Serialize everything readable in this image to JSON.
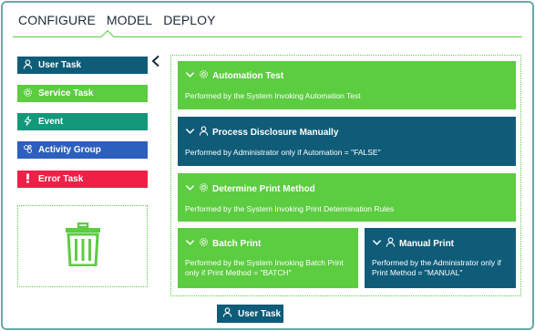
{
  "nav": {
    "tabs": [
      "CONFIGURE",
      "MODEL",
      "DEPLOY"
    ],
    "active": "MODEL"
  },
  "palette": {
    "items": [
      {
        "label": "User Task",
        "color": "#0f5c79",
        "icon": "user-icon"
      },
      {
        "label": "Service Task",
        "color": "#5ccc41",
        "icon": "gear-icon"
      },
      {
        "label": "Event",
        "color": "#14987a",
        "icon": "lightning-icon"
      },
      {
        "label": "Activity Group",
        "color": "#2d5fbf",
        "icon": "group-icon"
      },
      {
        "label": "Error Task",
        "color": "#ef2046",
        "icon": "exclamation-icon"
      }
    ],
    "trash_icon": "trash-icon"
  },
  "canvas": {
    "cards": [
      {
        "title": "Automation Test",
        "desc": "Performed by the System Invoking Automation Test",
        "color": "#5ccc41",
        "icon": "gear-icon"
      },
      {
        "title": "Process Disclosure Manually",
        "desc": "Performed by Administrator only if Automation = \"FALSE\"",
        "color": "#0f5c79",
        "icon": "user-icon"
      },
      {
        "title": "Determine Print Method",
        "desc": "Performed by the System Invoking Print Determination Rules",
        "color": "#5ccc41",
        "icon": "gear-icon"
      },
      {
        "title": "Batch Print",
        "desc": "Performed by the System Invoking Batch Print only if Print Method = \"BATCH\"",
        "color": "#5ccc41",
        "icon": "gear-icon"
      },
      {
        "title": "Manual Print",
        "desc": "Performed by the Administrator only if Print Method = \"MANUAL\"",
        "color": "#0f5c79",
        "icon": "user-icon"
      }
    ]
  },
  "drag_chip": {
    "label": "User Task",
    "icon": "user-icon"
  },
  "colors": {
    "accent": "#5ccc41",
    "teal": "#0f5c79",
    "border": "#6aa8a6"
  }
}
